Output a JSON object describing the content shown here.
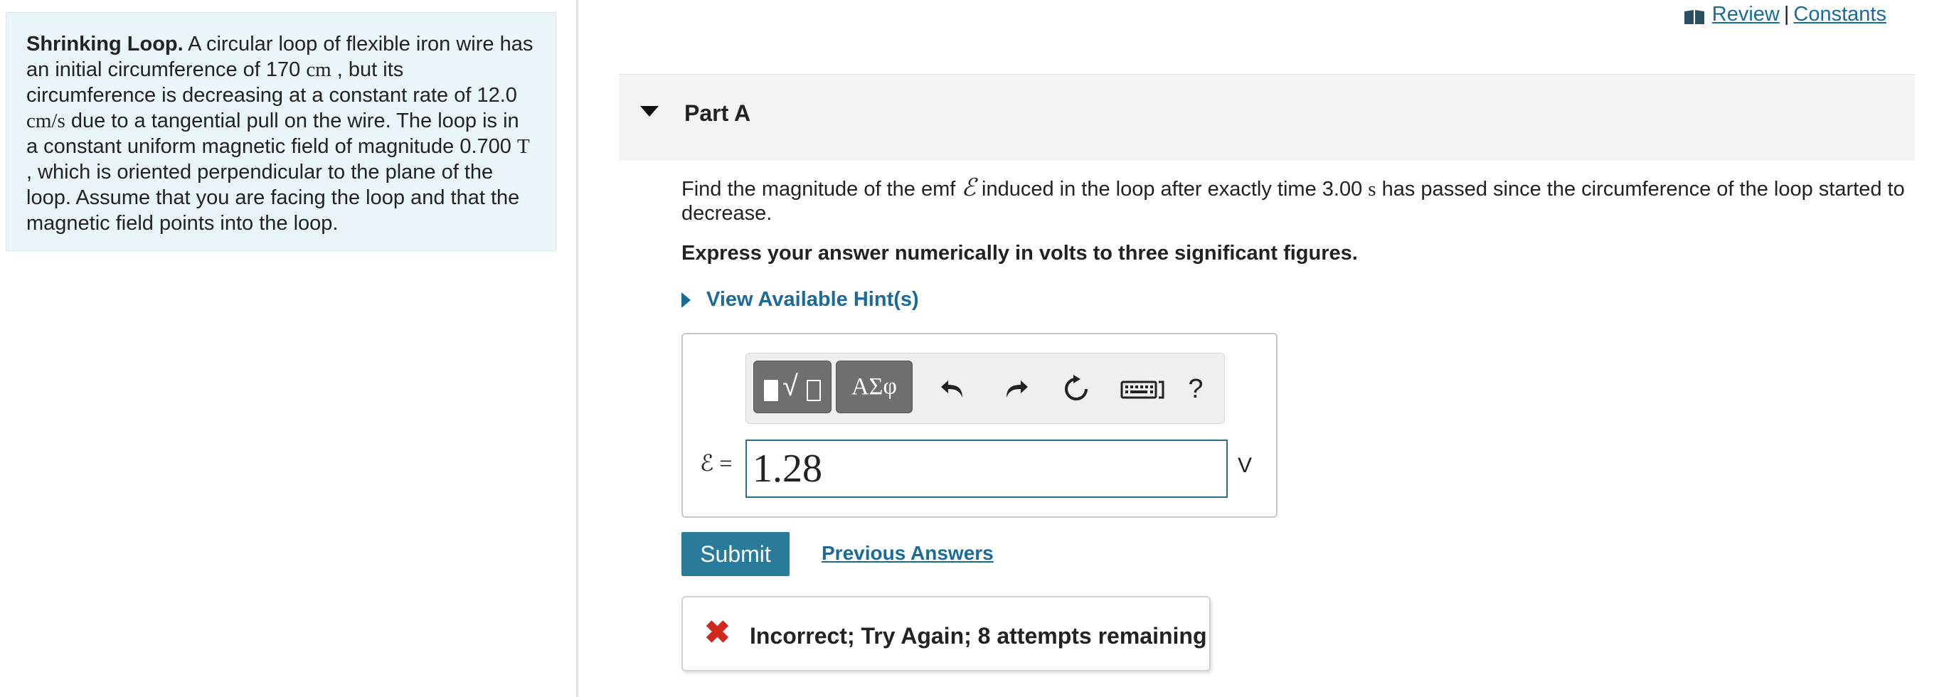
{
  "links": {
    "review": "Review",
    "separator": "|",
    "constants": "Constants"
  },
  "problem": {
    "title": "Shrinking Loop.",
    "t1": " A circular loop of flexible iron wire has an initial circumference of 170 ",
    "u1": "cm",
    "t2": " , but its circumference is decreasing at a constant rate of 12.0 ",
    "u2": "cm/s",
    "t3": " due to a tangential pull on the wire. The loop is in a constant uniform magnetic field of magnitude 0.700 ",
    "u3": "T",
    "t4": " , which is oriented perpendicular to the plane of the loop. Assume that you are facing the loop and that the magnetic field points into the loop."
  },
  "part": {
    "title": "Part A"
  },
  "question": {
    "q1": "Find the magnitude of the emf ",
    "symbol": "ℰ",
    "q2": " induced in the loop after exactly time 3.00 ",
    "unit": "s",
    "q3": " has passed since the circumference of the loop started to decrease.",
    "instruction": "Express your answer numerically in volts to three significant figures.",
    "hint_label": "View Available Hint(s)"
  },
  "toolbar": {
    "symbols_label": "ΑΣφ",
    "undo_icon": "undo-icon",
    "redo_icon": "redo-icon",
    "reset_icon": "reset-icon",
    "keyboard_icon": "keyboard-icon",
    "help_label": "?"
  },
  "answer": {
    "variable_label": "ℰ =",
    "value": "1.28",
    "unit": "V"
  },
  "actions": {
    "submit_label": "Submit",
    "previous_answers_label": "Previous Answers"
  },
  "feedback": {
    "message": "Incorrect; Try Again; 8 attempts remaining",
    "icon": "x-icon"
  },
  "colors": {
    "accent": "#1a6b98",
    "submit": "#2a7a9b",
    "panel": "#e9f5f8",
    "error": "#d0281d"
  }
}
